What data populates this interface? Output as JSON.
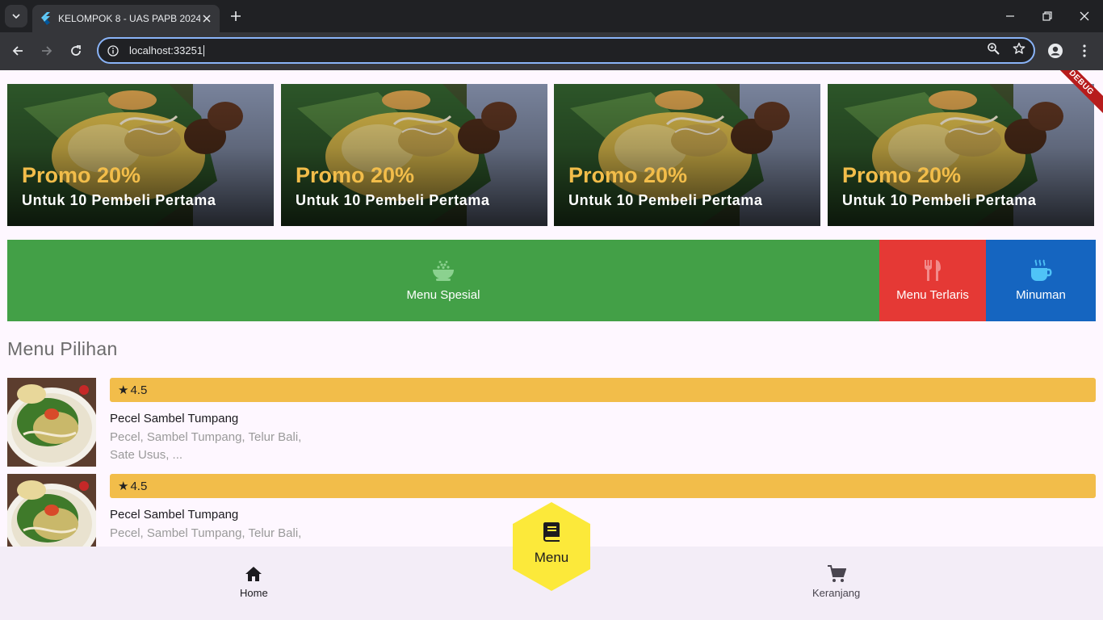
{
  "browser": {
    "tab_title": "KELOMPOK 8 - UAS PAPB 2024",
    "url": "localhost:33251",
    "icons": [
      "tab-search-icon",
      "flutter-favicon",
      "close-icon",
      "plus-icon",
      "minimize-icon",
      "restore-icon",
      "window-close-icon",
      "back-icon",
      "forward-icon",
      "reload-icon",
      "info-icon",
      "zoom-icon",
      "star-icon",
      "profile-icon",
      "kebab-icon"
    ]
  },
  "app": {
    "debug_label": "DEBUG",
    "promos": [
      {
        "title": "Promo 20%",
        "subtitle": "Untuk 10 Pembeli Pertama"
      },
      {
        "title": "Promo 20%",
        "subtitle": "Untuk 10 Pembeli Pertama"
      },
      {
        "title": "Promo 20%",
        "subtitle": "Untuk 10 Pembeli Pertama"
      },
      {
        "title": "Promo 20%",
        "subtitle": "Untuk 10 Pembeli Pertama"
      }
    ],
    "categories": [
      {
        "label": "Menu Spesial",
        "icon": "rice-bowl-icon",
        "color": "#43a047"
      },
      {
        "label": "Menu Terlaris",
        "icon": "restaurant-icon",
        "color": "#e53935"
      },
      {
        "label": "Minuman",
        "icon": "coffee-icon",
        "color": "#1565c0"
      }
    ],
    "section_title": "Menu Pilihan",
    "menu_items": [
      {
        "rating": "4.5",
        "name": "Pecel Sambel Tumpang",
        "description": "Pecel, Sambel Tumpang, Telur Bali, Sate Usus, ..."
      },
      {
        "rating": "4.5",
        "name": "Pecel Sambel Tumpang",
        "description": "Pecel, Sambel Tumpang, Telur Bali, Sate Usus, ..."
      }
    ],
    "nav": {
      "home": "Home",
      "menu": "Menu",
      "cart": "Keranjang"
    },
    "colors": {
      "accent_yellow": "#f2bd4a",
      "fab_yellow": "#fce93a",
      "background": "#fef7ff",
      "nav_bg": "#f3edf7"
    }
  }
}
